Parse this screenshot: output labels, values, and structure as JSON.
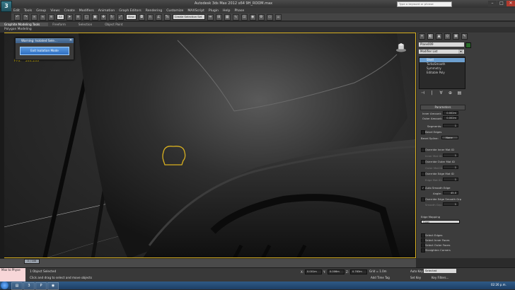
{
  "window": {
    "title": "Autodesk 3ds Max 2012 x64    9H_ROOM.max",
    "logo": "3",
    "search_placeholder": "Type a keyword or phrase",
    "min": "–",
    "max": "□",
    "close": "✕"
  },
  "menu": [
    "Edit",
    "Tools",
    "Group",
    "Views",
    "Create",
    "Modifiers",
    "Animation",
    "Graph Editors",
    "Rendering",
    "Customize",
    "MAXScript",
    "Plugin",
    "Help",
    "Phase"
  ],
  "toolbar": {
    "selection_filter": "All",
    "view": "View",
    "named_selection": "Create Selection Set"
  },
  "ribbon": {
    "tabs": [
      "Graphite Modeling Tools",
      "Freeform",
      "Selection",
      "Object Paint"
    ],
    "sub_label": "Polygon Modeling"
  },
  "viewport": {
    "fps_label": "FPS:",
    "fps_value": "244.233"
  },
  "dialog": {
    "title": "Warning: Isolated Sele...",
    "button": "Exit Isolation Mode",
    "close": "✕"
  },
  "command_panel": {
    "tabs": [
      "+",
      "◐",
      "▲",
      "◎",
      "▣",
      "✎"
    ],
    "object_name": "Plane009",
    "modifier_list": "Modifier List",
    "modifier_arrow": "▾",
    "stack": [
      "Shell",
      "TurboSmooth",
      "Symmetry",
      "Editable Poly"
    ],
    "stack_tools": [
      "⊣",
      "|",
      "∀",
      "⊕",
      "▤"
    ],
    "parameters_title": "Parameters",
    "inner_amount_label": "Inner Amount:",
    "inner_amount": "0.002m",
    "outer_amount_label": "Outer Amount:",
    "outer_amount": "0.002m",
    "segments_label": "Segments:",
    "segments": "1",
    "bevel_edges_label": "Bevel Edges",
    "bevel_spline_label": "Bevel Spline:",
    "bevel_spline": "None",
    "override_inner_mat_label": "Override Inner Mat ID",
    "inner_mat_id_label": "Inner Mat ID:",
    "inner_mat_id": "1",
    "override_outer_mat_label": "Override Outer Mat ID",
    "outer_mat_id_label": "Outer Mat ID:",
    "outer_mat_id": "1",
    "override_edge_mat_label": "Override Edge Mat ID",
    "edge_mat_id_label": "Edge Mat ID:",
    "edge_mat_id": "1",
    "auto_smooth_label": "Auto Smooth Edge",
    "angle_label": "Angle:",
    "angle": "45.0",
    "override_edge_smooth_label": "Override Edge Smooth Grp",
    "smooth_grp_label": "Smooth Grp:",
    "smooth_grp": "1",
    "edge_mapping_label": "Edge Mapping",
    "edge_mapping": "Copy",
    "select_edges": "Select Edges",
    "select_inner": "Select Inner Faces",
    "select_outer": "Select Outer Faces",
    "straighten": "Straighten Corners"
  },
  "timeline": {
    "slider": "0 / 100"
  },
  "status": {
    "maxscript_line1": "Max to Physe",
    "objects_selected": "1 Object Selected",
    "prompt": "Click and drag to select and move objects",
    "x_label": "X:",
    "x_value": "0.001m",
    "y_label": "Y:",
    "y_value": "0.006m",
    "z_label": "Z:",
    "z_value": "0.763m",
    "grid": "Grid = 1.0m",
    "add_time_tag": "Add Time Tag",
    "auto_key": "Auto Key",
    "selected": "Selected",
    "set_key": "Set Key",
    "key_filters": "Key Filters..."
  },
  "taskbar": {
    "clock": "02:26 p.m."
  }
}
